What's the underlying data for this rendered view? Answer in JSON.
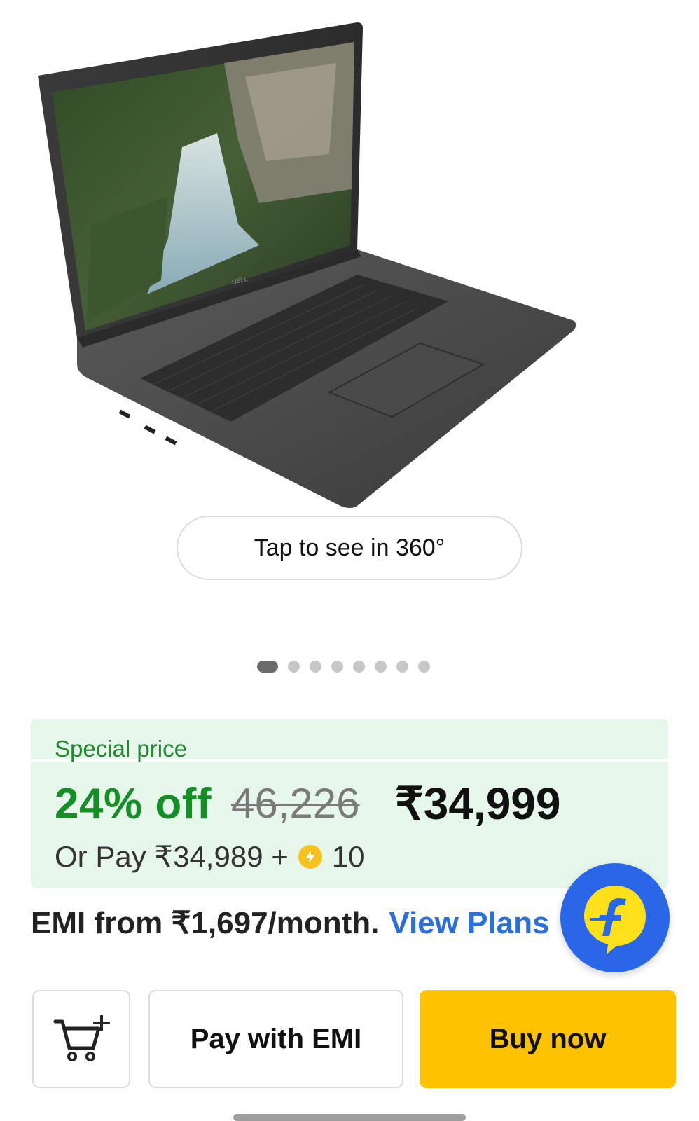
{
  "product": {
    "image_alt": "Dell laptop",
    "brand_logo_on_device": "DELL",
    "view_360_label": "Tap to see in 360°",
    "image_count": 8,
    "active_image_index": 0
  },
  "pricing": {
    "special_label": "Special price",
    "discount": "24% off",
    "mrp": "46,226",
    "price": "₹34,999",
    "or_pay_prefix": "Or Pay ₹34,989 +",
    "supercoins": "10",
    "coin_icon": "supercoin-icon"
  },
  "emi": {
    "text": "EMI from ₹1,697/month.",
    "link": "View Plans"
  },
  "floating_badge": {
    "icon": "flipkart-logo-icon"
  },
  "actions": {
    "cart_icon": "add-to-cart-icon",
    "pay_emi": "Pay with EMI",
    "buy_now": "Buy now"
  },
  "colors": {
    "discount_green": "#138f23",
    "price_box_bg": "#e7f6ea",
    "link_blue": "#2a6fdb",
    "buy_yellow": "#ffc200",
    "badge_blue": "#2966e8"
  }
}
